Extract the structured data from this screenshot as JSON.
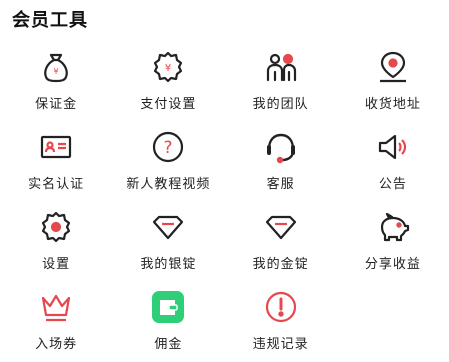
{
  "section": {
    "title": "会员工具"
  },
  "colors": {
    "accent": "#e5484d",
    "dark": "#222222",
    "wallet_green": "#2fcf7a"
  },
  "tools": [
    {
      "label": "保证金",
      "icon": "money-bag-icon"
    },
    {
      "label": "支付设置",
      "icon": "payment-settings-icon"
    },
    {
      "label": "我的团队",
      "icon": "team-icon"
    },
    {
      "label": "收货地址",
      "icon": "location-pin-icon"
    },
    {
      "label": "实名认证",
      "icon": "id-card-icon"
    },
    {
      "label": "新人教程视频",
      "icon": "question-icon"
    },
    {
      "label": "客服",
      "icon": "headset-icon"
    },
    {
      "label": "公告",
      "icon": "megaphone-icon"
    },
    {
      "label": "设置",
      "icon": "gear-icon"
    },
    {
      "label": "我的银锭",
      "icon": "silver-ingot-icon"
    },
    {
      "label": "我的金锭",
      "icon": "gold-ingot-icon"
    },
    {
      "label": "分享收益",
      "icon": "piggy-bank-icon"
    },
    {
      "label": "入场券",
      "icon": "crown-icon"
    },
    {
      "label": "佣金",
      "icon": "wallet-icon"
    },
    {
      "label": "违规记录",
      "icon": "warning-icon"
    }
  ]
}
